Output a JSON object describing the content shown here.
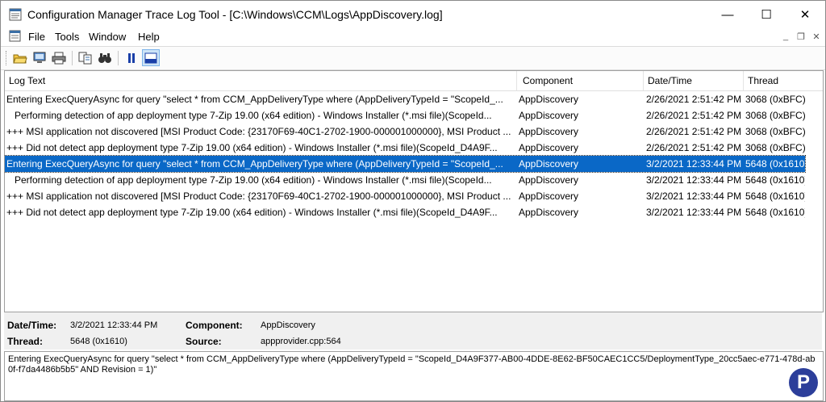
{
  "window": {
    "title": "Configuration Manager Trace Log Tool - [C:\\Windows\\CCM\\Logs\\AppDiscovery.log]",
    "caption_buttons": {
      "minimize": "—",
      "maximize": "☐",
      "close": "✕"
    }
  },
  "menu": {
    "items": [
      "File",
      "Tools",
      "Window",
      "Help"
    ],
    "mdi_buttons": {
      "minimize": "_",
      "restore": "❐",
      "close": "✕"
    }
  },
  "toolbar": {
    "buttons": [
      "open-icon",
      "open-on-server-icon",
      "print-icon",
      "copy-icon",
      "find-icon",
      "pause-icon",
      "show-details-icon"
    ]
  },
  "columns": {
    "log_text": "Log Text",
    "component": "Component",
    "datetime": "Date/Time",
    "thread": "Thread"
  },
  "rows": [
    {
      "text": "Entering ExecQueryAsync for query \"select * from CCM_AppDeliveryType where (AppDeliveryTypeId = \"ScopeId_...",
      "component": "AppDiscovery",
      "datetime": "2/26/2021 2:51:42 PM",
      "thread": "3068 (0xBFC)"
    },
    {
      "text": "   Performing detection of app deployment type 7-Zip 19.00 (x64 edition) - Windows Installer (*.msi file)(ScopeId...",
      "component": "AppDiscovery",
      "datetime": "2/26/2021 2:51:42 PM",
      "thread": "3068 (0xBFC)"
    },
    {
      "text": "+++ MSI application not discovered [MSI Product Code: {23170F69-40C1-2702-1900-000001000000}, MSI Product ...",
      "component": "AppDiscovery",
      "datetime": "2/26/2021 2:51:42 PM",
      "thread": "3068 (0xBFC)"
    },
    {
      "text": "+++ Did not detect app deployment type 7-Zip 19.00 (x64 edition) - Windows Installer (*.msi file)(ScopeId_D4A9F...",
      "component": "AppDiscovery",
      "datetime": "2/26/2021 2:51:42 PM",
      "thread": "3068 (0xBFC)"
    },
    {
      "text": "Entering ExecQueryAsync for query \"select * from CCM_AppDeliveryType where (AppDeliveryTypeId = \"ScopeId_...",
      "component": "AppDiscovery",
      "datetime": "3/2/2021 12:33:44 PM",
      "thread": "5648 (0x1610)",
      "selected": true
    },
    {
      "text": "   Performing detection of app deployment type 7-Zip 19.00 (x64 edition) - Windows Installer (*.msi file)(ScopeId...",
      "component": "AppDiscovery",
      "datetime": "3/2/2021 12:33:44 PM",
      "thread": "5648 (0x1610)"
    },
    {
      "text": "+++ MSI application not discovered [MSI Product Code: {23170F69-40C1-2702-1900-000001000000}, MSI Product ...",
      "component": "AppDiscovery",
      "datetime": "3/2/2021 12:33:44 PM",
      "thread": "5648 (0x1610)"
    },
    {
      "text": "+++ Did not detect app deployment type 7-Zip 19.00 (x64 edition) - Windows Installer (*.msi file)(ScopeId_D4A9F...",
      "component": "AppDiscovery",
      "datetime": "3/2/2021 12:33:44 PM",
      "thread": "5648 (0x1610)"
    }
  ],
  "details": {
    "datetime_label": "Date/Time:",
    "datetime_value": "3/2/2021 12:33:44 PM",
    "component_label": "Component:",
    "component_value": "AppDiscovery",
    "thread_label": "Thread:",
    "thread_value": "5648 (0x1610)",
    "source_label": "Source:",
    "source_value": "appprovider.cpp:564"
  },
  "message": "Entering ExecQueryAsync for query \"select * from CCM_AppDeliveryType where (AppDeliveryTypeId = \"ScopeId_D4A9F377-AB00-4DDE-8E62-BF50CAEC1CC5/DeploymentType_20cc5aec-e771-478d-ab0f-f7da4486b5b5\" AND Revision = 1)\"",
  "logo": {
    "letter": "P"
  },
  "colors": {
    "selection": "#0a68c7",
    "details_bg": "#f0f0f0"
  }
}
